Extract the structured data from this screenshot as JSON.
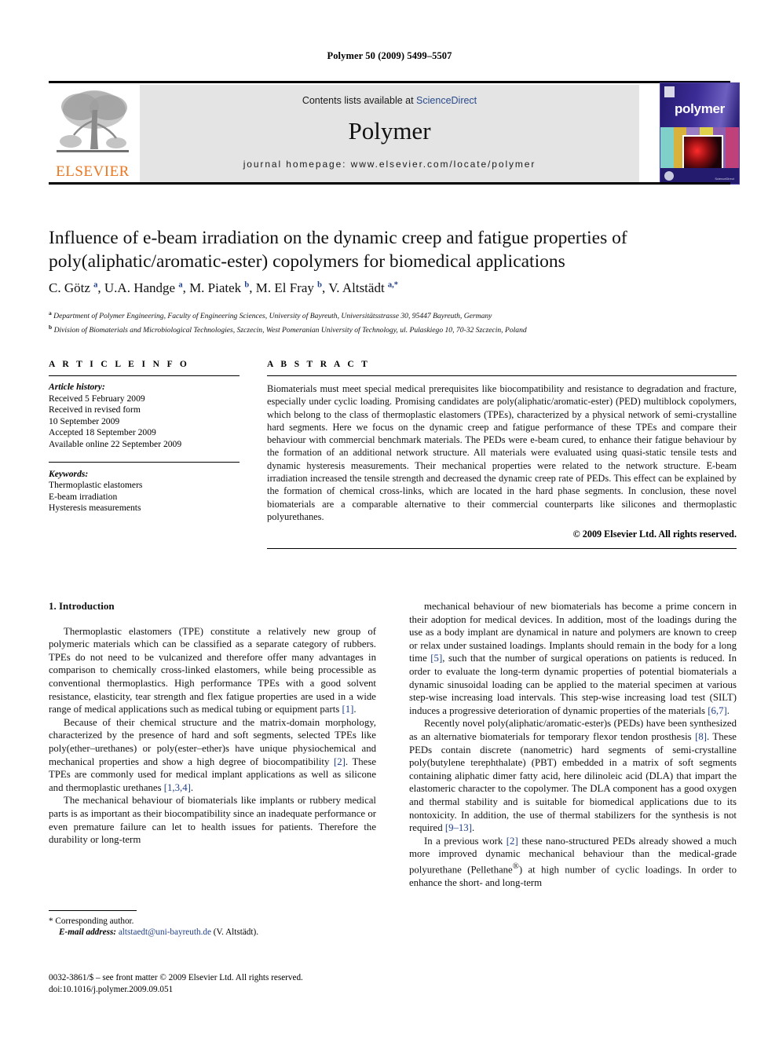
{
  "running_head": "Polymer 50 (2009) 5499–5507",
  "masthead": {
    "contents_prefix": "Contents lists available at ",
    "sciencedirect": "ScienceDirect",
    "journal_name": "Polymer",
    "homepage": "journal homepage: www.elsevier.com/locate/polymer",
    "publisher_wordmark": "ELSEVIER",
    "cover_title": "polymer",
    "cover_sciencedirect": "ScienceDirect",
    "link_color": "#2a4b8d",
    "banner_bg": "#e4e4e4",
    "elsevier_orange": "#E87722"
  },
  "article": {
    "title": "Influence of e-beam irradiation on the dynamic creep and fatigue properties of poly(aliphatic/aromatic-ester) copolymers for biomedical applications",
    "authors_html": "C. Götz <sup>a</sup>, U.A. Handge <sup>a</sup>, M. Piatek <sup>b</sup>, M. El Fray <sup>b</sup>, V. Altstädt <sup>a,*</sup>",
    "affiliation_a": "Department of Polymer Engineering, Faculty of Engineering Sciences, University of Bayreuth, Universitätsstrasse 30, 95447 Bayreuth, Germany",
    "affiliation_b": "Division of Biomaterials and Microbiological Technologies, Szczecin, West Pomeranian University of Technology, ul. Pulaskiego 10, 70-32 Szczecin, Poland"
  },
  "info": {
    "heading": "A R T I C L E   I N F O",
    "history_label": "Article history:",
    "history": [
      "Received 5 February 2009",
      "Received in revised form",
      "10 September 2009",
      "Accepted 18 September 2009",
      "Available online 22 September 2009"
    ],
    "keywords_label": "Keywords:",
    "keywords": [
      "Thermoplastic elastomers",
      "E-beam irradiation",
      "Hysteresis measurements"
    ]
  },
  "abstract": {
    "heading": "A B S T R A C T",
    "text": "Biomaterials must meet special medical prerequisites like biocompatibility and resistance to degradation and fracture, especially under cyclic loading. Promising candidates are poly(aliphatic/aromatic-ester) (PED) multiblock copolymers, which belong to the class of thermoplastic elastomers (TPEs), characterized by a physical network of semi-crystalline hard segments. Here we focus on the dynamic creep and fatigue performance of these TPEs and compare their behaviour with commercial benchmark materials. The PEDs were e-beam cured, to enhance their fatigue behaviour by the formation of an additional network structure. All materials were evaluated using quasi-static tensile tests and dynamic hysteresis measurements. Their mechanical properties were related to the network structure. E-beam irradiation increased the tensile strength and decreased the dynamic creep rate of PEDs. This effect can be explained by the formation of chemical cross-links, which are located in the hard phase segments. In conclusion, these novel biomaterials are a comparable alternative to their commercial counterparts like silicones and thermoplastic polyurethanes.",
    "copyright": "© 2009 Elsevier Ltd. All rights reserved."
  },
  "body": {
    "section_title": "1. Introduction",
    "left_paragraphs": [
      "Thermoplastic elastomers (TPE) constitute a relatively new group of polymeric materials which can be classified as a separate category of rubbers. TPEs do not need to be vulcanized and therefore offer many advantages in comparison to chemically cross-linked elastomers, while being processible as conventional thermoplastics. High performance TPEs with a good solvent resistance, elasticity, tear strength and flex fatigue properties are used in a wide range of medical applications such as medical tubing or equipment parts [1].",
      "Because of their chemical structure and the matrix-domain morphology, characterized by the presence of hard and soft segments, selected TPEs like poly(ether–urethanes) or poly(ester–ether)s have unique physiochemical and mechanical properties and show a high degree of biocompatibility [2]. These TPEs are commonly used for medical implant applications as well as silicone and thermoplastic urethanes [1,3,4].",
      "The mechanical behaviour of biomaterials like implants or rubbery medical parts is as important as their biocompatibility since an inadequate performance or even premature failure can let to health issues for patients. Therefore the durability or long-term"
    ],
    "right_paragraphs": [
      "mechanical behaviour of new biomaterials has become a prime concern in their adoption for medical devices. In addition, most of the loadings during the use as a body implant are dynamical in nature and polymers are known to creep or relax under sustained loadings. Implants should remain in the body for a long time [5], such that the number of surgical operations on patients is reduced. In order to evaluate the long-term dynamic properties of potential biomaterials a dynamic sinusoidal loading can be applied to the material specimen at various step-wise increasing load intervals. This step-wise increasing load test (SILT) induces a progressive deterioration of dynamic properties of the materials [6,7].",
      "Recently novel poly(aliphatic/aromatic-ester)s (PEDs) have been synthesized as an alternative biomaterials for temporary flexor tendon prosthesis [8]. These PEDs contain discrete (nanometric) hard segments of semi-crystalline poly(butylene terephthalate) (PBT) embedded in a matrix of soft segments containing aliphatic dimer fatty acid, here dilinoleic acid (DLA) that impart the elastomeric character to the copolymer. The DLA component has a good oxygen and thermal stability and is suitable for biomedical applications due to its nontoxicity. In addition, the use of thermal stabilizers for the synthesis is not required [9–13].",
      "In a previous work [2] these nano-structured PEDs already showed a much more improved dynamic mechanical behaviour than the medical-grade polyurethane (Pellethane®) at high number of cyclic loadings. In order to enhance the short- and long-term"
    ]
  },
  "footnote": {
    "corresponding": "* Corresponding author.",
    "email_label": "E-mail address:",
    "email": "altstaedt@uni-bayreuth.de",
    "email_owner": "(V. Altstädt).",
    "issn_line": "0032-3861/$ – see front matter © 2009 Elsevier Ltd. All rights reserved.",
    "doi_line": "doi:10.1016/j.polymer.2009.09.051"
  }
}
